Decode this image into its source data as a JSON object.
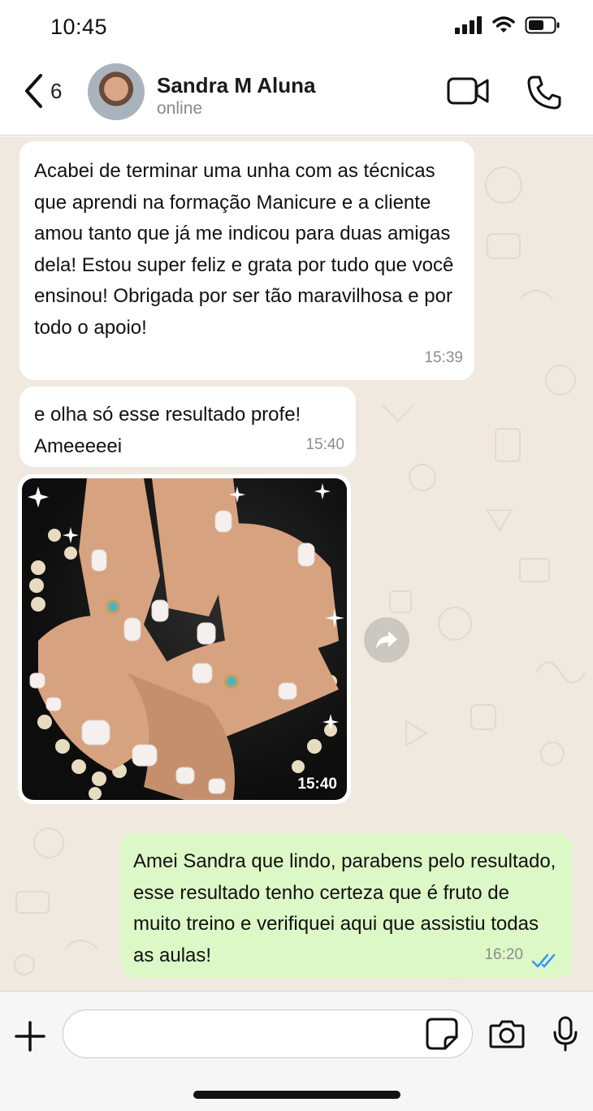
{
  "status_bar": {
    "time": "10:45"
  },
  "header": {
    "back_count": "6",
    "contact_name": "Sandra M Aluna",
    "contact_status": "online"
  },
  "messages": [
    {
      "direction": "incoming",
      "text": "Acabei de terminar uma unha com as técnicas que aprendi na formação Manicure e a cliente amou tanto que já me indicou para duas amigas dela! Estou super feliz e grata por tudo que você ensinou! Obrigada por ser tão maravilhosa e por todo o apoio!",
      "time": "15:39"
    },
    {
      "direction": "incoming",
      "text": "e olha só esse resultado profe! Ameeeeei",
      "time": "15:40"
    },
    {
      "direction": "incoming",
      "type": "image",
      "time": "15:40"
    },
    {
      "direction": "outgoing",
      "text": "Amei Sandra que lindo, parabens pelo resultado, esse resultado tenho certeza que é fruto de muito treino e verifiquei aqui que assistiu todas as aulas!",
      "time": "16:20",
      "status": "read"
    }
  ],
  "composer": {
    "placeholder": ""
  },
  "colors": {
    "incoming_bubble": "#ffffff",
    "outgoing_bubble": "#dcf8c6",
    "read_ticks": "#3497f9",
    "chat_background": "#efe9e0"
  },
  "icons": {
    "back": "chevron-left-icon",
    "video": "video-camera-icon",
    "call": "phone-icon",
    "forward": "forward-arrow-icon",
    "plus": "plus-icon",
    "sticker": "sticker-icon",
    "camera": "camera-icon",
    "mic": "microphone-icon"
  }
}
